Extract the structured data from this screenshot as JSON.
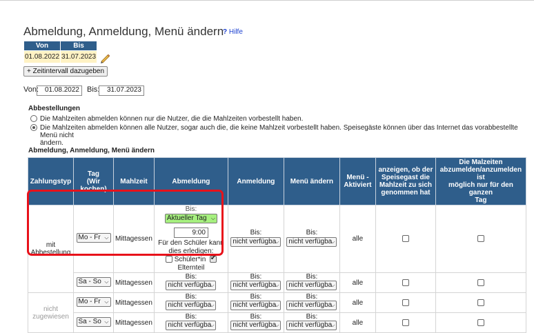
{
  "title": "Abmeldung, Anmeldung, Menü ändern",
  "help_label": "Hilfe",
  "period_table": {
    "col_from": "Von",
    "col_to": "Bis",
    "from": "01.08.2022",
    "to": "31.07.2023"
  },
  "add_interval_label": "+ Zeitintervall dazugeben",
  "filter": {
    "from_label": "Von:",
    "from_value": "01.08.2022",
    "to_label": "Bis:",
    "to_value": "31.07.2023"
  },
  "abbestellungen": {
    "title": "Abbestellungen",
    "option1": "Die Mahlzeiten abmelden können nur die Nutzer, die die Mahlzeiten vorbestellt haben.",
    "option2_line1": "Die Mahlzeiten abmelden können alle Nutzer, sogar auch die, die keine Mahlzeit vorbestellt haben. Speisegäste können über das Internet das vorabbestellte Menü nicht",
    "option2_line2": "ändern."
  },
  "table_title": "Abmeldung, Anmeldung, Menü ändern",
  "headers": {
    "zahlungstyp": "Zahlungstyp",
    "tag1": "Tag",
    "tag2": "(Wir",
    "tag3": "kochen)",
    "mahlzeit": "Mahlzeit",
    "abmeldung": "Abmeldung",
    "anmeldung": "Anmeldung",
    "menu_aendern": "Menü ändern",
    "menu_aktiviert1": "Menü -",
    "menu_aktiviert2": "Aktiviert",
    "anzeigen1": "anzeigen, ob der",
    "anzeigen2": "Speisegast die",
    "anzeigen3": "Mahlzeit zu sich",
    "anzeigen4": "genommen hat",
    "ganzen1": "Die Malzeiten",
    "ganzen2": "abzumelden/anzumelden ist",
    "ganzen3": "möglich nur für den ganzen",
    "ganzen4": "Tag"
  },
  "rows": [
    {
      "zahlungstyp1": "mit",
      "zahlungstyp2": "Abbestellung",
      "tag": "Mo - Fr",
      "mahlzeit": "Mittagessen",
      "abm_bis": "Bis:",
      "abm_select": "Aktueller Tag",
      "abm_time": "9:00",
      "abm_note1": "Für den Schüler kann",
      "abm_note2": "dies erledigen:",
      "abm_schueler": "Schüler*in",
      "abm_eltern": "Elternteil",
      "anm_bis": "Bis:",
      "anm_select": "nicht verfügba",
      "menu_bis": "Bis:",
      "menu_select": "nicht verfügba",
      "aktiviert": "alle"
    },
    {
      "tag": "Sa - So",
      "mahlzeit": "Mittagessen",
      "abm_bis": "Bis:",
      "abm_select": "nicht verfügba",
      "anm_bis": "Bis:",
      "anm_select": "nicht verfügba",
      "menu_bis": "Bis:",
      "menu_select": "nicht verfügba",
      "aktiviert": "alle"
    },
    {
      "zahlungstyp1": "nicht",
      "zahlungstyp2": "zugewiesen",
      "tag": "Mo - Fr",
      "mahlzeit": "Mittagessen",
      "abm_bis": "Bis:",
      "abm_select": "nicht verfügba",
      "anm_bis": "Bis:",
      "anm_select": "nicht verfügba",
      "menu_bis": "Bis:",
      "menu_select": "nicht verfügba",
      "aktiviert": "alle"
    },
    {
      "tag": "Sa - So",
      "mahlzeit": "Mittagessen",
      "abm_bis": "Bis:",
      "abm_select": "nicht verfügba",
      "anm_bis": "Bis:",
      "anm_select": "nicht verfügba",
      "menu_bis": "Bis:",
      "menu_select": "nicht verfügba",
      "aktiviert": "alle"
    }
  ],
  "colors": {
    "header_bg": "#2f5e8b",
    "period_bg": "#fff2c4",
    "green_select": "#a6f07f",
    "highlight": "#e8111a",
    "link": "#1a3fd0"
  }
}
